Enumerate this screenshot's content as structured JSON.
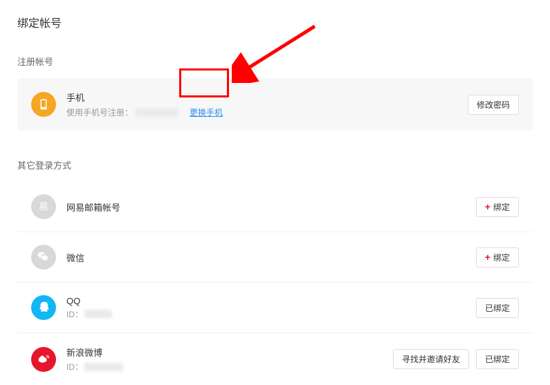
{
  "page_title": "绑定帐号",
  "register_section": {
    "title": "注册帐号",
    "phone": {
      "name": "手机",
      "sub_prefix": "使用手机号注册：",
      "change_link": "更换手机",
      "change_password_btn": "修改密码"
    }
  },
  "other_section": {
    "title": "其它登录方式",
    "items": [
      {
        "icon": "netease",
        "name": "网易邮箱帐号",
        "sub": null,
        "buttons": [
          {
            "type": "bind",
            "label": "绑定",
            "plus": true
          }
        ]
      },
      {
        "icon": "wechat",
        "name": "微信",
        "sub": null,
        "buttons": [
          {
            "type": "bind",
            "label": "绑定",
            "plus": true
          }
        ]
      },
      {
        "icon": "qq",
        "name": "QQ",
        "sub": "ID：",
        "buttons": [
          {
            "type": "bound",
            "label": "已绑定",
            "plus": false
          }
        ]
      },
      {
        "icon": "weibo",
        "name": "新浪微博",
        "sub": "ID：",
        "buttons": [
          {
            "type": "invite",
            "label": "寻找并邀请好友",
            "plus": false
          },
          {
            "type": "bound",
            "label": "已绑定",
            "plus": false
          }
        ]
      }
    ]
  }
}
